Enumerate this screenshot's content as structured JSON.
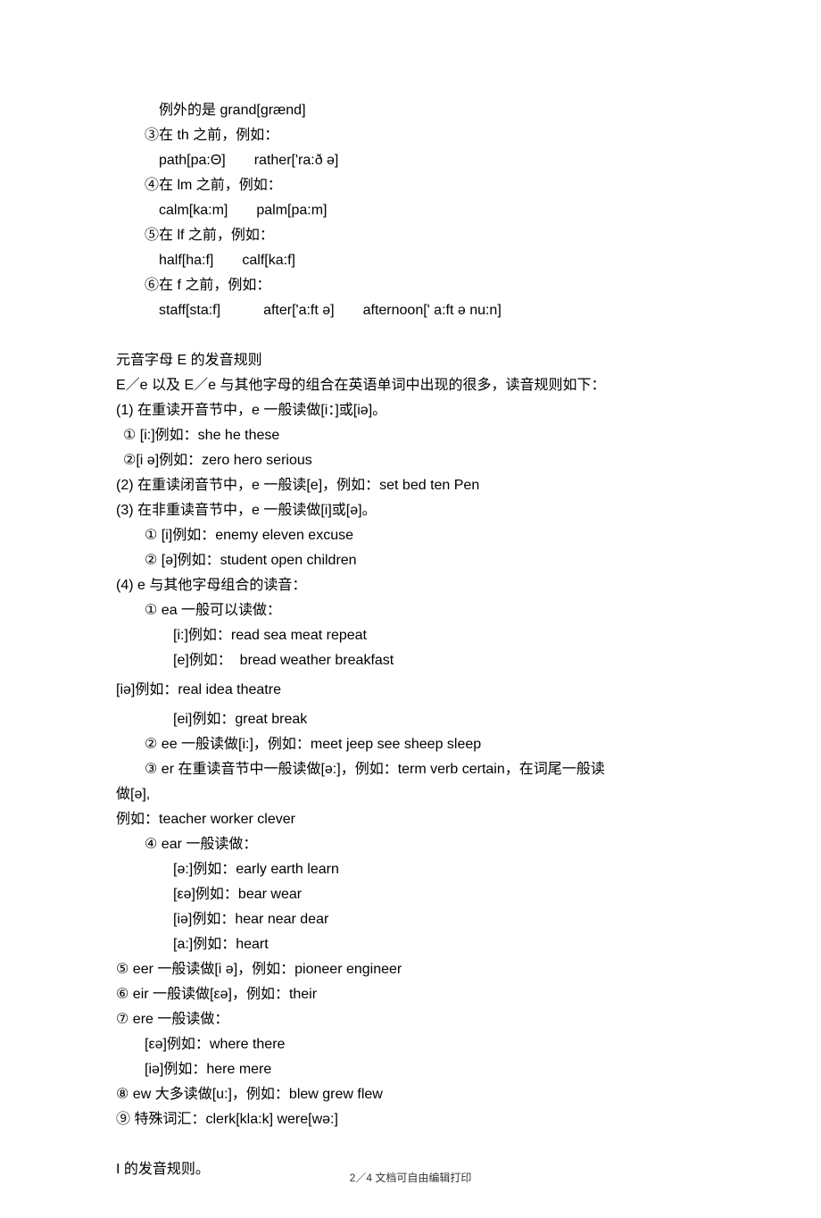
{
  "lines": [
    {
      "cls": "indent2",
      "text": "例外的是 grand[grænd]"
    },
    {
      "cls": "indent1",
      "text": "③在 th 之前，例如："
    },
    {
      "cls": "indent2",
      "text": "path[pa:Θ]　　rather['ra:ð ə]"
    },
    {
      "cls": "indent1",
      "text": "④在 lm 之前，例如："
    },
    {
      "cls": "indent2",
      "text": "calm[ka:m]　　palm[pa:m]"
    },
    {
      "cls": "indent1",
      "text": "⑤在 lf 之前，例如："
    },
    {
      "cls": "indent2",
      "text": "half[ha:f]　　calf[ka:f]"
    },
    {
      "cls": "indent1",
      "text": "⑥在 f 之前，例如："
    },
    {
      "cls": "indent2",
      "text": "staff[sta:f]　　　after['a:ft ə]　　afternoon[' a:ft ə nu:n]"
    },
    {
      "cls": "spacer",
      "text": ""
    },
    {
      "cls": "",
      "text": "元音字母 E 的发音规则"
    },
    {
      "cls": "",
      "text": "E／e 以及 E／e 与其他字母的组合在英语单词中出现的很多，读音规则如下："
    },
    {
      "cls": "",
      "text": "(1) 在重读开音节中，e 一般读做[i：]或[iə]。"
    },
    {
      "cls": "indent05",
      "text": "① [i:]例如：she he these"
    },
    {
      "cls": "indent05",
      "text": "②[i ə]例如：zero hero serious"
    },
    {
      "cls": "",
      "text": "(2) 在重读闭音节中，e 一般读[e]，例如：set bed ten Pen"
    },
    {
      "cls": "",
      "text": "(3) 在非重读音节中，e 一般读做[i]或[ə]。"
    },
    {
      "cls": "indent1",
      "text": "① [i]例如：enemy eleven excuse"
    },
    {
      "cls": "indent1",
      "text": "② [ə]例如：student open children"
    },
    {
      "cls": "",
      "text": "(4) e 与其他字母组合的读音："
    },
    {
      "cls": "indent1",
      "text": "① ea 一般可以读做："
    },
    {
      "cls": "indent3",
      "text": "[i:]例如：read sea meat repeat"
    },
    {
      "cls": "indent3",
      "text": "[e]例如：  bread weather breakfast"
    },
    {
      "cls": "indent3",
      "text": "[iə]例如：real idea theatre",
      "pad": "5px 0"
    },
    {
      "cls": "indent3",
      "text": "[ei]例如：great break"
    },
    {
      "cls": "indent1",
      "text": "② ee 一般读做[i:]，例如：meet jeep see sheep sleep"
    },
    {
      "cls": "indent1",
      "text": "③ er 在重读音节中一般读做[ə:]，例如：term verb certain，在词尾一般读"
    },
    {
      "cls": "",
      "text": "做[ə],"
    },
    {
      "cls": "",
      "text": "例如：teacher worker clever"
    },
    {
      "cls": "indent1",
      "text": "④ ear 一般读做："
    },
    {
      "cls": "indent3",
      "text": "[ə:]例如：early earth learn"
    },
    {
      "cls": "indent3",
      "text": "[εə]例如：bear wear"
    },
    {
      "cls": "indent3",
      "text": "[iə]例如：hear near dear"
    },
    {
      "cls": "indent3",
      "text": "[a:]例如：heart"
    },
    {
      "cls": "",
      "text": "⑤ eer 一般读做[i ə]，例如：pioneer engineer"
    },
    {
      "cls": "",
      "text": "⑥ eir 一般读做[εə]，例如：their"
    },
    {
      "cls": "",
      "text": "⑦ ere 一般读做："
    },
    {
      "cls": "indent1",
      "text": "[εə]例如：where there"
    },
    {
      "cls": "indent1",
      "text": "[iə]例如：here mere"
    },
    {
      "cls": "",
      "text": "⑧ ew 大多读做[u:]，例如：blew grew flew"
    },
    {
      "cls": "",
      "text": "⑨ 特殊词汇：clerk[kla:k] were[wə:]"
    },
    {
      "cls": "spacer",
      "text": ""
    },
    {
      "cls": "",
      "text": "I 的发音规则。"
    }
  ],
  "footer": "2／4 文档可自由编辑打印"
}
